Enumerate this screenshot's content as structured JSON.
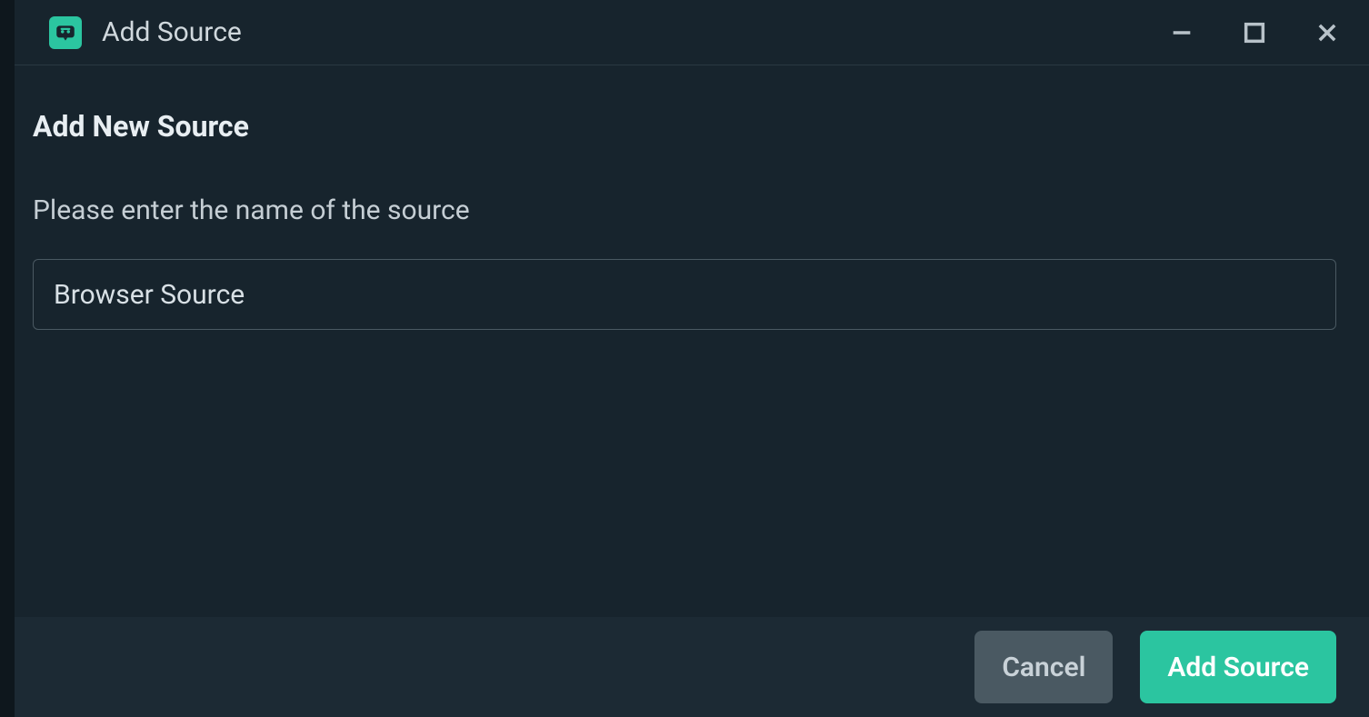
{
  "titlebar": {
    "title": "Add Source"
  },
  "main": {
    "heading": "Add New Source",
    "prompt": "Please enter the name of the source",
    "input_value": "Browser Source"
  },
  "footer": {
    "cancel_label": "Cancel",
    "submit_label": "Add Source"
  },
  "colors": {
    "accent": "#2bc5a0",
    "bg": "#17242D",
    "footer_bg": "#1c2a34"
  }
}
